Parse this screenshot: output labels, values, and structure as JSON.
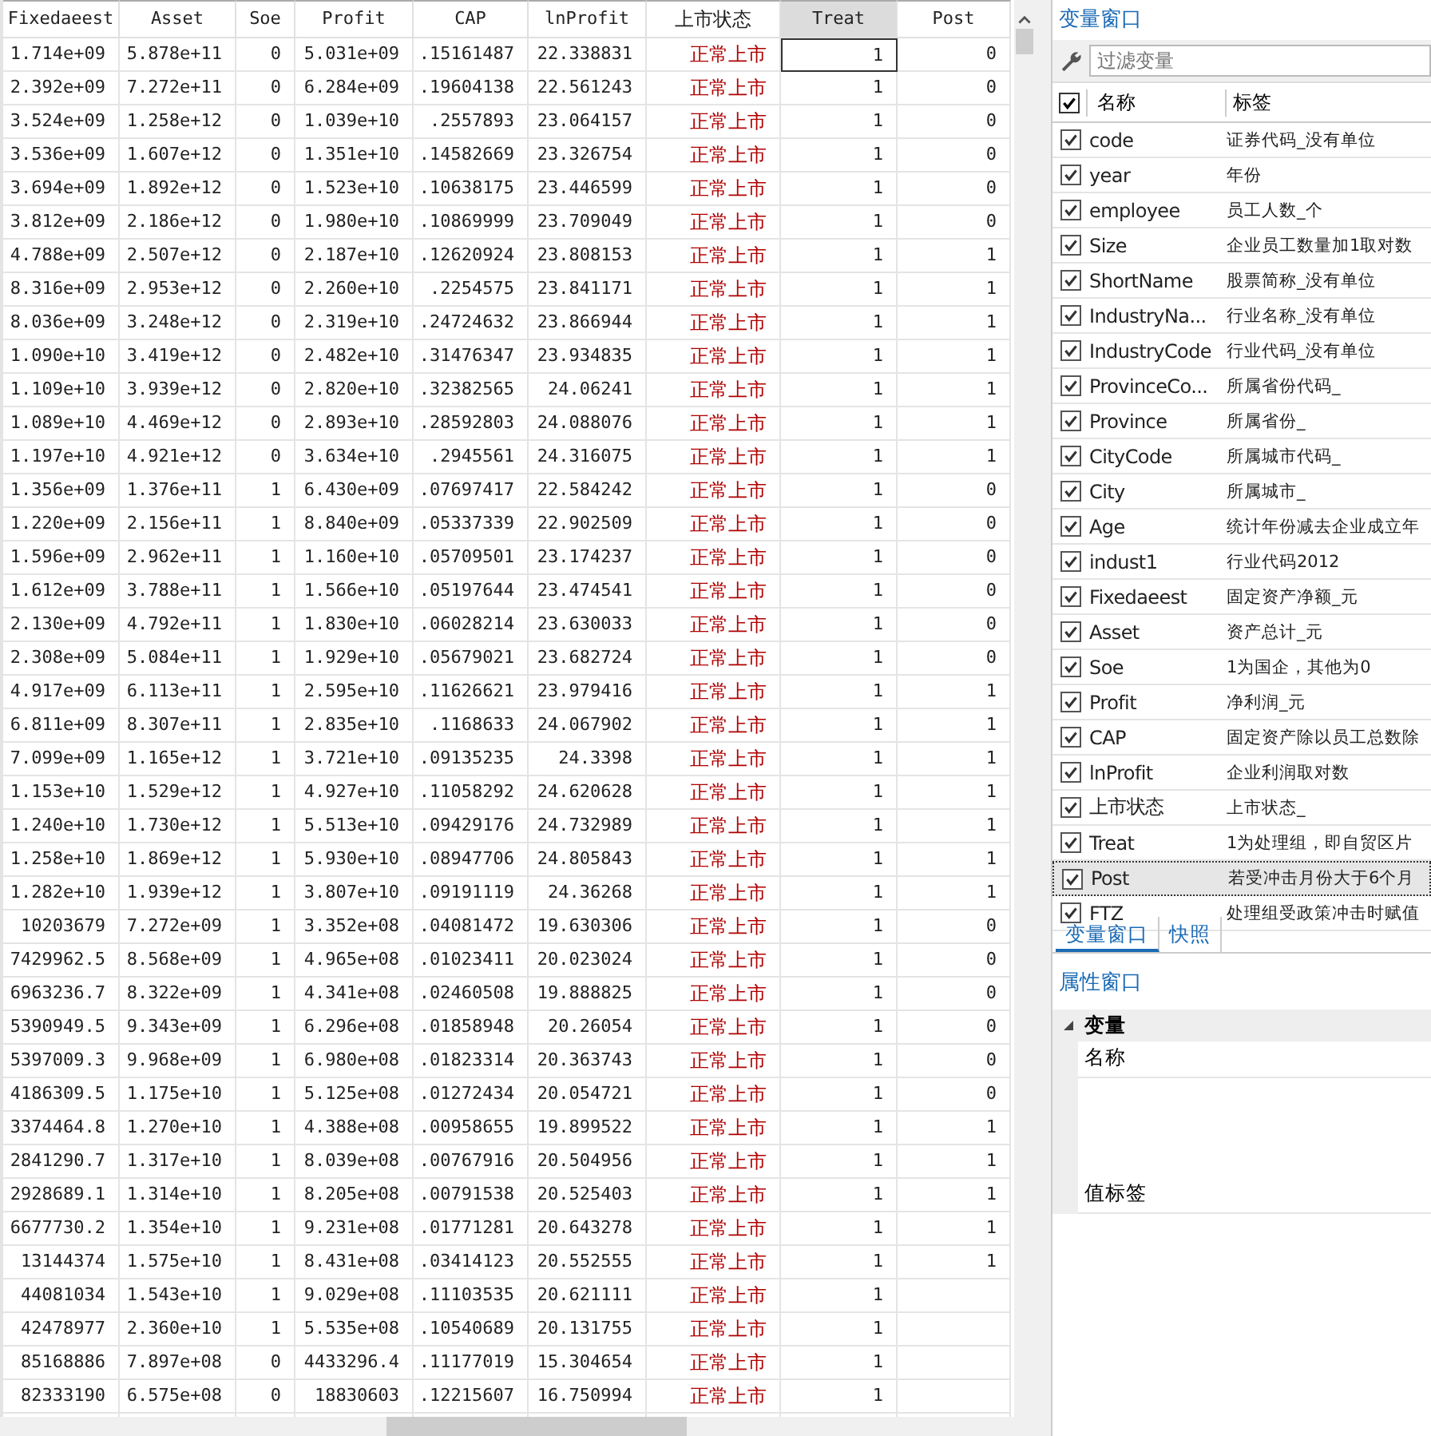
{
  "table": {
    "columns": [
      {
        "label": "Fixedaeest",
        "selected": false
      },
      {
        "label": "Asset",
        "selected": false
      },
      {
        "label": "Soe",
        "selected": false
      },
      {
        "label": "Profit",
        "selected": false
      },
      {
        "label": "CAP",
        "selected": false
      },
      {
        "label": "lnProfit",
        "selected": false
      },
      {
        "label": "上市状态",
        "selected": false
      },
      {
        "label": "Treat",
        "selected": true
      },
      {
        "label": "Post",
        "selected": false
      }
    ],
    "rows": [
      {
        "selected": true,
        "cells": [
          "1.714e+09",
          "5.878e+11",
          "0",
          "5.031e+09",
          ".15161487",
          "22.338831",
          "正常上市",
          "1",
          "0"
        ]
      },
      {
        "selected": false,
        "cells": [
          "2.392e+09",
          "7.272e+11",
          "0",
          "6.284e+09",
          ".19604138",
          "22.561243",
          "正常上市",
          "1",
          "0"
        ]
      },
      {
        "selected": false,
        "cells": [
          "3.524e+09",
          "1.258e+12",
          "0",
          "1.039e+10",
          ".2557893",
          "23.064157",
          "正常上市",
          "1",
          "0"
        ]
      },
      {
        "selected": false,
        "cells": [
          "3.536e+09",
          "1.607e+12",
          "0",
          "1.351e+10",
          ".14582669",
          "23.326754",
          "正常上市",
          "1",
          "0"
        ]
      },
      {
        "selected": false,
        "cells": [
          "3.694e+09",
          "1.892e+12",
          "0",
          "1.523e+10",
          ".10638175",
          "23.446599",
          "正常上市",
          "1",
          "0"
        ]
      },
      {
        "selected": false,
        "cells": [
          "3.812e+09",
          "2.186e+12",
          "0",
          "1.980e+10",
          ".10869999",
          "23.709049",
          "正常上市",
          "1",
          "0"
        ]
      },
      {
        "selected": false,
        "cells": [
          "4.788e+09",
          "2.507e+12",
          "0",
          "2.187e+10",
          ".12620924",
          "23.808153",
          "正常上市",
          "1",
          "1"
        ]
      },
      {
        "selected": false,
        "cells": [
          "8.316e+09",
          "2.953e+12",
          "0",
          "2.260e+10",
          ".2254575",
          "23.841171",
          "正常上市",
          "1",
          "1"
        ]
      },
      {
        "selected": false,
        "cells": [
          "8.036e+09",
          "3.248e+12",
          "0",
          "2.319e+10",
          ".24724632",
          "23.866944",
          "正常上市",
          "1",
          "1"
        ]
      },
      {
        "selected": false,
        "cells": [
          "1.090e+10",
          "3.419e+12",
          "0",
          "2.482e+10",
          ".31476347",
          "23.934835",
          "正常上市",
          "1",
          "1"
        ]
      },
      {
        "selected": false,
        "cells": [
          "1.109e+10",
          "3.939e+12",
          "0",
          "2.820e+10",
          ".32382565",
          "24.06241",
          "正常上市",
          "1",
          "1"
        ]
      },
      {
        "selected": false,
        "cells": [
          "1.089e+10",
          "4.469e+12",
          "0",
          "2.893e+10",
          ".28592803",
          "24.088076",
          "正常上市",
          "1",
          "1"
        ]
      },
      {
        "selected": false,
        "cells": [
          "1.197e+10",
          "4.921e+12",
          "0",
          "3.634e+10",
          ".2945561",
          "24.316075",
          "正常上市",
          "1",
          "1"
        ]
      },
      {
        "selected": false,
        "cells": [
          "1.356e+09",
          "1.376e+11",
          "1",
          "6.430e+09",
          ".07697417",
          "22.584242",
          "正常上市",
          "1",
          "0"
        ]
      },
      {
        "selected": false,
        "cells": [
          "1.220e+09",
          "2.156e+11",
          "1",
          "8.840e+09",
          ".05337339",
          "22.902509",
          "正常上市",
          "1",
          "0"
        ]
      },
      {
        "selected": false,
        "cells": [
          "1.596e+09",
          "2.962e+11",
          "1",
          "1.160e+10",
          ".05709501",
          "23.174237",
          "正常上市",
          "1",
          "0"
        ]
      },
      {
        "selected": false,
        "cells": [
          "1.612e+09",
          "3.788e+11",
          "1",
          "1.566e+10",
          ".05197644",
          "23.474541",
          "正常上市",
          "1",
          "0"
        ]
      },
      {
        "selected": false,
        "cells": [
          "2.130e+09",
          "4.792e+11",
          "1",
          "1.830e+10",
          ".06028214",
          "23.630033",
          "正常上市",
          "1",
          "0"
        ]
      },
      {
        "selected": false,
        "cells": [
          "2.308e+09",
          "5.084e+11",
          "1",
          "1.929e+10",
          ".05679021",
          "23.682724",
          "正常上市",
          "1",
          "0"
        ]
      },
      {
        "selected": false,
        "cells": [
          "4.917e+09",
          "6.113e+11",
          "1",
          "2.595e+10",
          ".11626621",
          "23.979416",
          "正常上市",
          "1",
          "1"
        ]
      },
      {
        "selected": false,
        "cells": [
          "6.811e+09",
          "8.307e+11",
          "1",
          "2.835e+10",
          ".1168633",
          "24.067902",
          "正常上市",
          "1",
          "1"
        ]
      },
      {
        "selected": false,
        "cells": [
          "7.099e+09",
          "1.165e+12",
          "1",
          "3.721e+10",
          ".09135235",
          "24.3398",
          "正常上市",
          "1",
          "1"
        ]
      },
      {
        "selected": false,
        "cells": [
          "1.153e+10",
          "1.529e+12",
          "1",
          "4.927e+10",
          ".11058292",
          "24.620628",
          "正常上市",
          "1",
          "1"
        ]
      },
      {
        "selected": false,
        "cells": [
          "1.240e+10",
          "1.730e+12",
          "1",
          "5.513e+10",
          ".09429176",
          "24.732989",
          "正常上市",
          "1",
          "1"
        ]
      },
      {
        "selected": false,
        "cells": [
          "1.258e+10",
          "1.869e+12",
          "1",
          "5.930e+10",
          ".08947706",
          "24.805843",
          "正常上市",
          "1",
          "1"
        ]
      },
      {
        "selected": false,
        "cells": [
          "1.282e+10",
          "1.939e+12",
          "1",
          "3.807e+10",
          ".09191119",
          "24.36268",
          "正常上市",
          "1",
          "1"
        ]
      },
      {
        "selected": false,
        "cells": [
          "10203679",
          "7.272e+09",
          "1",
          "3.352e+08",
          ".04081472",
          "19.630306",
          "正常上市",
          "1",
          "0"
        ]
      },
      {
        "selected": false,
        "cells": [
          "7429962.5",
          "8.568e+09",
          "1",
          "4.965e+08",
          ".01023411",
          "20.023024",
          "正常上市",
          "1",
          "0"
        ]
      },
      {
        "selected": false,
        "cells": [
          "6963236.7",
          "8.322e+09",
          "1",
          "4.341e+08",
          ".02460508",
          "19.888825",
          "正常上市",
          "1",
          "0"
        ]
      },
      {
        "selected": false,
        "cells": [
          "5390949.5",
          "9.343e+09",
          "1",
          "6.296e+08",
          ".01858948",
          "20.26054",
          "正常上市",
          "1",
          "0"
        ]
      },
      {
        "selected": false,
        "cells": [
          "5397009.3",
          "9.968e+09",
          "1",
          "6.980e+08",
          ".01823314",
          "20.363743",
          "正常上市",
          "1",
          "0"
        ]
      },
      {
        "selected": false,
        "cells": [
          "4186309.5",
          "1.175e+10",
          "1",
          "5.125e+08",
          ".01272434",
          "20.054721",
          "正常上市",
          "1",
          "0"
        ]
      },
      {
        "selected": false,
        "cells": [
          "3374464.8",
          "1.270e+10",
          "1",
          "4.388e+08",
          ".00958655",
          "19.899522",
          "正常上市",
          "1",
          "1"
        ]
      },
      {
        "selected": false,
        "cells": [
          "2841290.7",
          "1.317e+10",
          "1",
          "8.039e+08",
          ".00767916",
          "20.504956",
          "正常上市",
          "1",
          "1"
        ]
      },
      {
        "selected": false,
        "cells": [
          "2928689.1",
          "1.314e+10",
          "1",
          "8.205e+08",
          ".00791538",
          "20.525403",
          "正常上市",
          "1",
          "1"
        ]
      },
      {
        "selected": false,
        "cells": [
          "6677730.2",
          "1.354e+10",
          "1",
          "9.231e+08",
          ".01771281",
          "20.643278",
          "正常上市",
          "1",
          "1"
        ]
      },
      {
        "selected": false,
        "cells": [
          "13144374",
          "1.575e+10",
          "1",
          "8.431e+08",
          ".03414123",
          "20.552555",
          "正常上市",
          "1",
          "1"
        ]
      },
      {
        "selected": false,
        "cells": [
          "44081034",
          "1.543e+10",
          "1",
          "9.029e+08",
          ".11103535",
          "20.621111",
          "正常上市",
          "1"
        ]
      },
      {
        "selected": false,
        "cells": [
          "42478977",
          "2.360e+10",
          "1",
          "5.535e+08",
          ".10540689",
          "20.131755",
          "正常上市",
          "1"
        ]
      },
      {
        "selected": false,
        "cells": [
          "85168886",
          "7.897e+08",
          "0",
          "4433296.4",
          ".11177019",
          "15.304654",
          "正常上市",
          "1"
        ]
      },
      {
        "selected": false,
        "cells": [
          "82333190",
          "6.575e+08",
          "0",
          "18830603",
          ".12215607",
          "16.750994",
          "正常上市",
          "1"
        ]
      }
    ]
  },
  "variables_panel": {
    "title": "变量窗口",
    "filter": {
      "placeholder": "过滤变量"
    },
    "header": {
      "checked": true,
      "name_column": "名称",
      "label_column": "标签"
    },
    "variables": [
      {
        "name": "code",
        "label": "证券代码_没有单位",
        "checked": true,
        "selected": false
      },
      {
        "name": "year",
        "label": "年份",
        "checked": true,
        "selected": false
      },
      {
        "name": "employee",
        "label": "员工人数_个",
        "checked": true,
        "selected": false
      },
      {
        "name": "Size",
        "label": "企业员工数量加1取对数",
        "checked": true,
        "selected": false
      },
      {
        "name": "ShortName",
        "label": "股票简称_没有单位",
        "checked": true,
        "selected": false
      },
      {
        "name": "IndustryNa...",
        "label": "行业名称_没有单位",
        "checked": true,
        "selected": false
      },
      {
        "name": "IndustryCode",
        "label": "行业代码_没有单位",
        "checked": true,
        "selected": false
      },
      {
        "name": "ProvinceCo...",
        "label": "所属省份代码_",
        "checked": true,
        "selected": false
      },
      {
        "name": "Province",
        "label": "所属省份_",
        "checked": true,
        "selected": false
      },
      {
        "name": "CityCode",
        "label": "所属城市代码_",
        "checked": true,
        "selected": false
      },
      {
        "name": "City",
        "label": "所属城市_",
        "checked": true,
        "selected": false
      },
      {
        "name": "Age",
        "label": "统计年份减去企业成立年",
        "checked": true,
        "selected": false
      },
      {
        "name": "indust1",
        "label": "行业代码2012",
        "checked": true,
        "selected": false
      },
      {
        "name": "Fixedaeest",
        "label": "固定资产净额_元",
        "checked": true,
        "selected": false
      },
      {
        "name": "Asset",
        "label": "资产总计_元",
        "checked": true,
        "selected": false
      },
      {
        "name": "Soe",
        "label": "1为国企，其他为0",
        "checked": true,
        "selected": false
      },
      {
        "name": "Profit",
        "label": "净利润_元",
        "checked": true,
        "selected": false
      },
      {
        "name": "CAP",
        "label": "固定资产除以员工总数除",
        "checked": true,
        "selected": false
      },
      {
        "name": "lnProfit",
        "label": "企业利润取对数",
        "checked": true,
        "selected": false
      },
      {
        "name": "上市状态",
        "label": "上市状态_",
        "checked": true,
        "selected": false
      },
      {
        "name": "Treat",
        "label": "1为处理组，即自贸区片",
        "checked": true,
        "selected": false
      },
      {
        "name": "Post",
        "label": "若受冲击月份大于6个月",
        "checked": true,
        "selected": true
      },
      {
        "name": "FTZ",
        "label": "处理组受政策冲击时赋值",
        "checked": true,
        "selected": false
      }
    ]
  },
  "panel_tabs": [
    {
      "label": "变量窗口",
      "selected": true
    },
    {
      "label": "快照",
      "selected": false
    }
  ],
  "properties_panel": {
    "title": "属性窗口",
    "group": {
      "label": "变量",
      "expanded": true,
      "items": [
        "名称",
        "值标签"
      ]
    }
  }
}
